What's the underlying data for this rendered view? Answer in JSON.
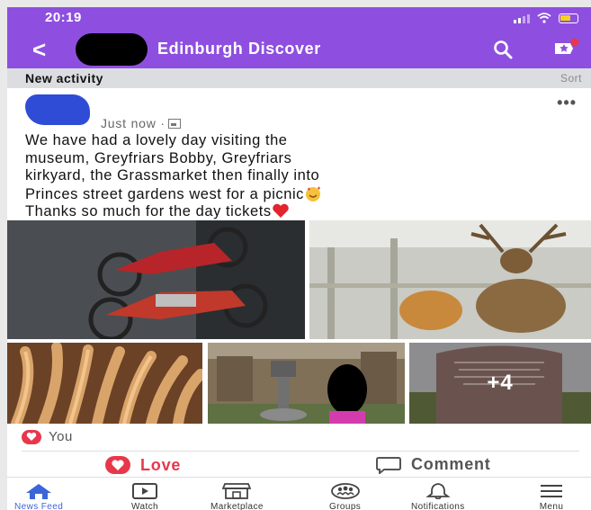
{
  "status_bar": {
    "time": "20:19"
  },
  "header": {
    "back_glyph": "<",
    "title": "Edinburgh Discover"
  },
  "section": {
    "title": "New activity",
    "sort_label": "Sort"
  },
  "post": {
    "timestamp": "Just now ·",
    "more_glyph": "•••",
    "lines": [
      "We have had a lovely day visiting the",
      "museum, Greyfriars Bobby, Greyfriars",
      "kirkyard, the Grassmarket then finally into",
      "Princes street gardens west for a picnic",
      "Thanks so much for the day tickets"
    ],
    "more_photos_label": "+4"
  },
  "reactions": {
    "label": "You"
  },
  "actions": {
    "love_label": "Love",
    "comment_label": "Comment"
  },
  "tabs": [
    {
      "label": "News Feed"
    },
    {
      "label": "Watch"
    },
    {
      "label": "Marketplace"
    },
    {
      "label": "Groups"
    },
    {
      "label": "Notifications"
    },
    {
      "label": "Menu"
    }
  ],
  "colors": {
    "brand": "#8e4fe0",
    "love": "#e7384b",
    "active_tab": "#3b66d9",
    "section_bg": "#dcdde0"
  }
}
